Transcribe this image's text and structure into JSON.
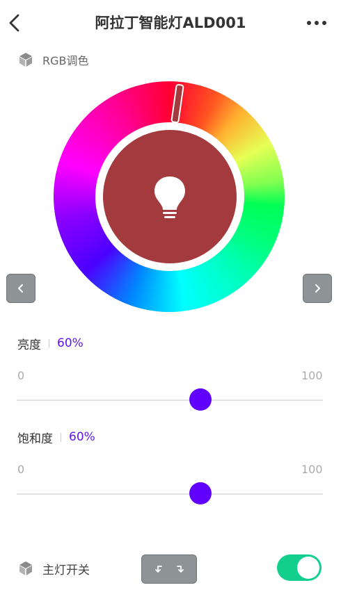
{
  "header": {
    "title": "阿拉丁智能灯ALD001"
  },
  "rgb_section": {
    "label": "RGB调色",
    "selected_color": "#a33a3e"
  },
  "brightness": {
    "label": "亮度",
    "value_text": "60%",
    "value": 60,
    "min": "0",
    "max": "100"
  },
  "saturation": {
    "label": "饱和度",
    "value_text": "60%",
    "value": 60,
    "min": "0",
    "max": "100"
  },
  "main_light": {
    "label": "主灯开关",
    "switch_on": true
  },
  "colors": {
    "accent": "#6000ff",
    "value_text": "#5b16f0",
    "toggle_on": "#13cf8e",
    "side_button": "#8e9396"
  },
  "icons": {
    "back": "chevron-left-icon",
    "more": "more-horizontal-icon",
    "section": "cube-icon",
    "bulb": "light-bulb-icon",
    "prev": "chevron-left-icon",
    "next": "chevron-right-icon",
    "action_left": "turn-left-icon",
    "action_right": "turn-right-icon"
  }
}
